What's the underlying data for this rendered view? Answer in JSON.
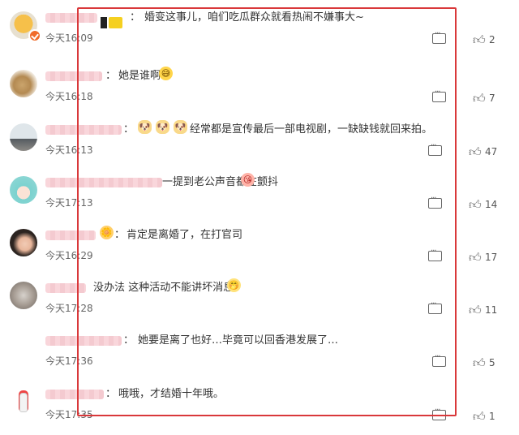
{
  "comments": [
    {
      "text": "婚变这事儿，咱们吃瓜群众就看热闹不嫌事大~",
      "time": "今天16:09",
      "likes": "2",
      "avatar_icon": "orange-cartoon-avatar",
      "has_verified_badge": true
    },
    {
      "text": "她是谁啊",
      "time": "今天16:18",
      "likes": "7",
      "avatar_icon": "dog-avatar",
      "emoji": [
        "sweat-emoji"
      ]
    },
    {
      "text": "经常都是宣传最后一部电视剧，一缺缺钱就回来拍。",
      "time": "今天16:13",
      "likes": "47",
      "avatar_icon": "photo-avatar",
      "emoji": [
        "dog-emoji",
        "dog-emoji",
        "dog-emoji"
      ]
    },
    {
      "text": "一提到老公声音都在颤抖",
      "time": "今天17:13",
      "likes": "14",
      "avatar_icon": "cartoon-girl-avatar",
      "emoji": [
        "kiss-emoji"
      ]
    },
    {
      "text": "肯定是离婚了，在打官司",
      "time": "今天16:29",
      "likes": "17",
      "avatar_icon": "woman-avatar"
    },
    {
      "text": "没办法 这种活动不能讲坏消息",
      "time": "今天17:28",
      "likes": "11",
      "avatar_icon": "blurry-photo-avatar",
      "emoji": [
        "smile-emoji"
      ]
    },
    {
      "text": "她要是离了也好…毕竟可以回香港发展了…",
      "time": "今天17:36",
      "likes": "5",
      "avatar_icon": ""
    },
    {
      "text": "哦哦，才结婚十年哦。",
      "time": "今天17:35",
      "likes": "1",
      "avatar_icon": "rabbit-avatar"
    }
  ],
  "colors": {
    "highlight_box": "#d9383a",
    "text": "#333333",
    "meta": "#666666"
  }
}
